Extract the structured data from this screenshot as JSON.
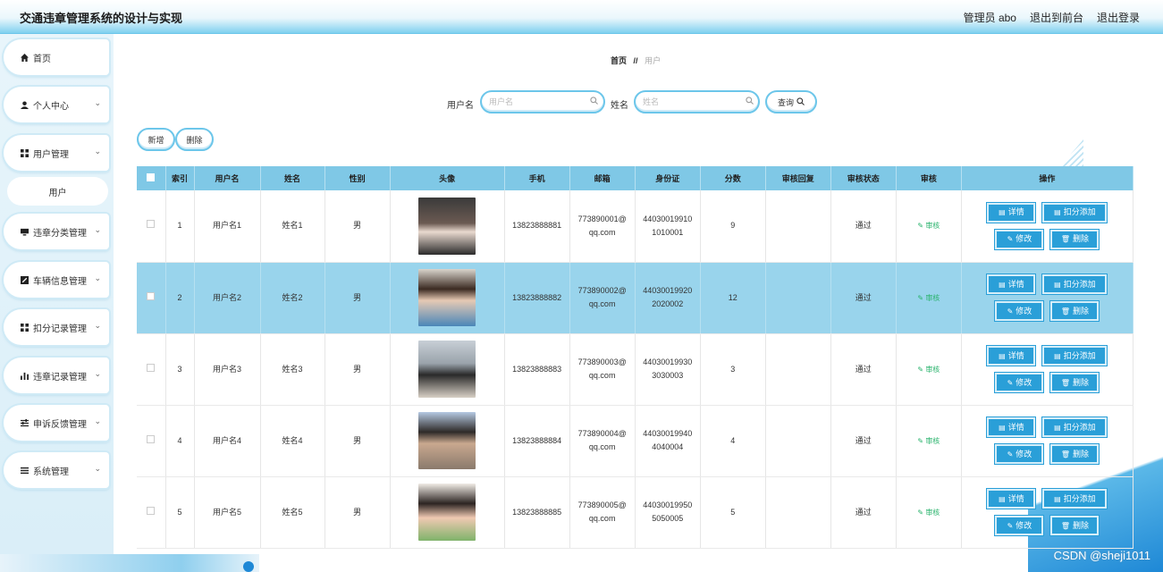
{
  "header": {
    "title": "交通违章管理系统的设计与实现",
    "admin": "管理员 abo",
    "front": "退出到前台",
    "logout": "退出登录"
  },
  "sidebar": {
    "items": [
      {
        "label": "首页",
        "icon": "home-icon"
      },
      {
        "label": "个人中心",
        "icon": "user-icon"
      },
      {
        "label": "用户管理",
        "icon": "grid-icon"
      },
      {
        "label": "违章分类管理",
        "icon": "monitor-icon"
      },
      {
        "label": "车辆信息管理",
        "icon": "edit-square-icon"
      },
      {
        "label": "扣分记录管理",
        "icon": "grid-icon"
      },
      {
        "label": "违章记录管理",
        "icon": "bar-chart-icon"
      },
      {
        "label": "申诉反馈管理",
        "icon": "sliders-icon"
      },
      {
        "label": "系统管理",
        "icon": "list-icon"
      }
    ],
    "sub_user": "用户"
  },
  "breadcrumb": {
    "home": "首页",
    "sep": "//",
    "current": "用户"
  },
  "search": {
    "username_label": "用户名",
    "username_placeholder": "用户名",
    "name_label": "姓名",
    "name_placeholder": "姓名",
    "query_label": "查询"
  },
  "actions": {
    "add": "新增",
    "delete": "删除"
  },
  "table": {
    "headers": [
      "索引",
      "用户名",
      "姓名",
      "性别",
      "头像",
      "手机",
      "邮箱",
      "身份证",
      "分数",
      "审核回复",
      "审核状态",
      "审核",
      "操作"
    ],
    "rows": [
      {
        "idx": "1",
        "username": "用户名1",
        "name": "姓名1",
        "gender": "男",
        "phone": "13823888881",
        "email1": "773890001@",
        "email2": "qq.com",
        "id1": "44030019910",
        "id2": "1010001",
        "score": "9",
        "reply": "",
        "status": "通过",
        "audit": "审核"
      },
      {
        "idx": "2",
        "username": "用户名2",
        "name": "姓名2",
        "gender": "男",
        "phone": "13823888882",
        "email1": "773890002@",
        "email2": "qq.com",
        "id1": "44030019920",
        "id2": "2020002",
        "score": "12",
        "reply": "",
        "status": "通过",
        "audit": "审核"
      },
      {
        "idx": "3",
        "username": "用户名3",
        "name": "姓名3",
        "gender": "男",
        "phone": "13823888883",
        "email1": "773890003@",
        "email2": "qq.com",
        "id1": "44030019930",
        "id2": "3030003",
        "score": "3",
        "reply": "",
        "status": "通过",
        "audit": "审核"
      },
      {
        "idx": "4",
        "username": "用户名4",
        "name": "姓名4",
        "gender": "男",
        "phone": "13823888884",
        "email1": "773890004@",
        "email2": "qq.com",
        "id1": "44030019940",
        "id2": "4040004",
        "score": "4",
        "reply": "",
        "status": "通过",
        "audit": "审核"
      },
      {
        "idx": "5",
        "username": "用户名5",
        "name": "姓名5",
        "gender": "男",
        "phone": "13823888885",
        "email1": "773890005@",
        "email2": "qq.com",
        "id1": "44030019950",
        "id2": "5050005",
        "score": "5",
        "reply": "",
        "status": "通过",
        "audit": "审核"
      }
    ],
    "ops": {
      "detail": "详情",
      "deduct_add": "扣分添加",
      "edit": "修改",
      "remove": "删除"
    }
  },
  "watermark": "CSDN @sheji1011",
  "colors": {
    "accent": "#2a9fd8",
    "header_row": "#7fc8e6",
    "highlight_row": "#99d4ec",
    "audit_green": "#29b36c"
  }
}
